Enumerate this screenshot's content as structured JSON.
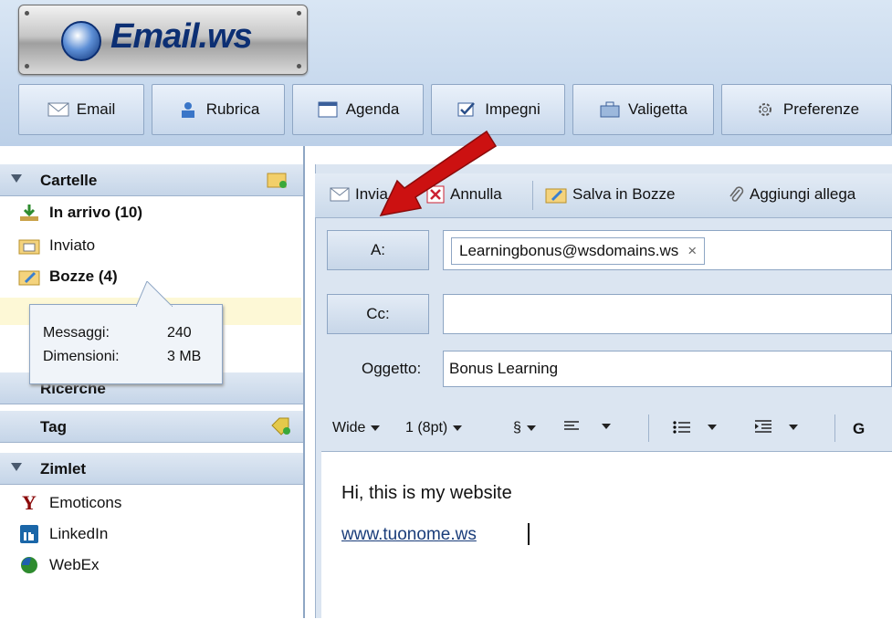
{
  "brand": {
    "name": "Email.ws"
  },
  "nav": [
    {
      "label": "Email",
      "icon": "envelope-icon"
    },
    {
      "label": "Rubrica",
      "icon": "contacts-icon"
    },
    {
      "label": "Agenda",
      "icon": "calendar-icon"
    },
    {
      "label": "Impegni",
      "icon": "checkbox-icon"
    },
    {
      "label": "Valigetta",
      "icon": "briefcase-icon"
    },
    {
      "label": "Preferenze",
      "icon": "gear-icon"
    }
  ],
  "sidebar": {
    "folders_title": "Cartelle",
    "folders": [
      {
        "label": "In arrivo (10)",
        "bold": true
      },
      {
        "label": "Inviato",
        "bold": false
      },
      {
        "label": "Bozze (4)",
        "bold": true
      }
    ],
    "tooltip": {
      "messages_label": "Messaggi:",
      "messages_value": "240",
      "size_label": "Dimensioni:",
      "size_value": "3 MB"
    },
    "searches_title": "Ricerche",
    "tag_title": "Tag",
    "zimlet_title": "Zimlet",
    "zimlets": [
      {
        "label": "Emoticons",
        "icon": "yahoo-icon"
      },
      {
        "label": "LinkedIn",
        "icon": "linkedin-icon"
      },
      {
        "label": "WebEx",
        "icon": "webex-icon"
      }
    ]
  },
  "compose": {
    "toolbar": {
      "send": "Invia",
      "cancel": "Annulla",
      "save_draft": "Salva in Bozze",
      "attach": "Aggiungi allega"
    },
    "to_label": "A:",
    "to_chip": "Learningbonus@wsdomains.ws",
    "chip_remove": "×",
    "cc_label": "Cc:",
    "subject_label": "Oggetto:",
    "subject_value": "Bonus Learning",
    "format": {
      "font": "Wide",
      "size": "1 (8pt)",
      "para": "§",
      "bold": "G"
    },
    "body_line1": "Hi, this is my website",
    "body_link": "www.tuonome.ws"
  },
  "colors": {
    "arrow": "#cc1111",
    "accent": "#0c2f73"
  }
}
